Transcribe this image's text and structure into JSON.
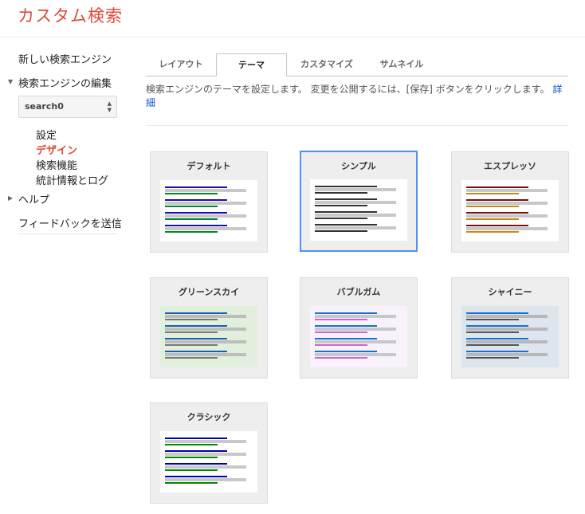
{
  "app": {
    "title": "カスタム検索"
  },
  "sidebar": {
    "new_engine": "新しい検索エンジン",
    "edit_engine": "検索エンジンの編集",
    "engine_select": {
      "value": "search0"
    },
    "sub_items": [
      {
        "label": "設定"
      },
      {
        "label": "デザイン"
      },
      {
        "label": "検索機能"
      },
      {
        "label": "統計情報とログ"
      }
    ],
    "help": "ヘルプ",
    "feedback": "フィードバックを送信"
  },
  "tabs": [
    {
      "label": "レイアウト"
    },
    {
      "label": "テーマ"
    },
    {
      "label": "カスタマイズ"
    },
    {
      "label": "サムネイル"
    }
  ],
  "description": {
    "text": "検索エンジンのテーマを設定します。 変更を公開するには、[保存] ボタンをクリックします。",
    "link": "詳細"
  },
  "themes": [
    {
      "name": "デフォルト",
      "selected": false,
      "bg": "#ffffff",
      "title_color": "#1a0dab",
      "url_color": "#00862c",
      "snippet_color": "#c8c8c8"
    },
    {
      "name": "シンプル",
      "selected": true,
      "bg": "#ffffff",
      "title_color": "#333333",
      "url_color": "#333333",
      "snippet_color": "#c8c8c8"
    },
    {
      "name": "エスプレッソ",
      "selected": false,
      "bg": "#ffffff",
      "title_color": "#7a1010",
      "url_color": "#c58a1a",
      "snippet_color": "#c8c8c8"
    },
    {
      "name": "グリーンスカイ",
      "selected": false,
      "bg": "#e1efdd",
      "title_color": "#1a5fb4",
      "url_color": "#777777",
      "snippet_color": "#bdbdbd"
    },
    {
      "name": "バブルガム",
      "selected": false,
      "bg": "#f7f2fb",
      "title_color": "#1a6fd4",
      "url_color": "#cc66cc",
      "snippet_color": "#c8c8c8"
    },
    {
      "name": "シャイニー",
      "selected": false,
      "bg": "#dde6ee",
      "title_color": "#1a6fd4",
      "url_color": "#555555",
      "snippet_color": "#b8b8b8"
    },
    {
      "name": "クラシック",
      "selected": false,
      "bg": "#ffffff",
      "title_color": "#0000aa",
      "url_color": "#008800",
      "snippet_color": "#c8c8c8"
    }
  ]
}
